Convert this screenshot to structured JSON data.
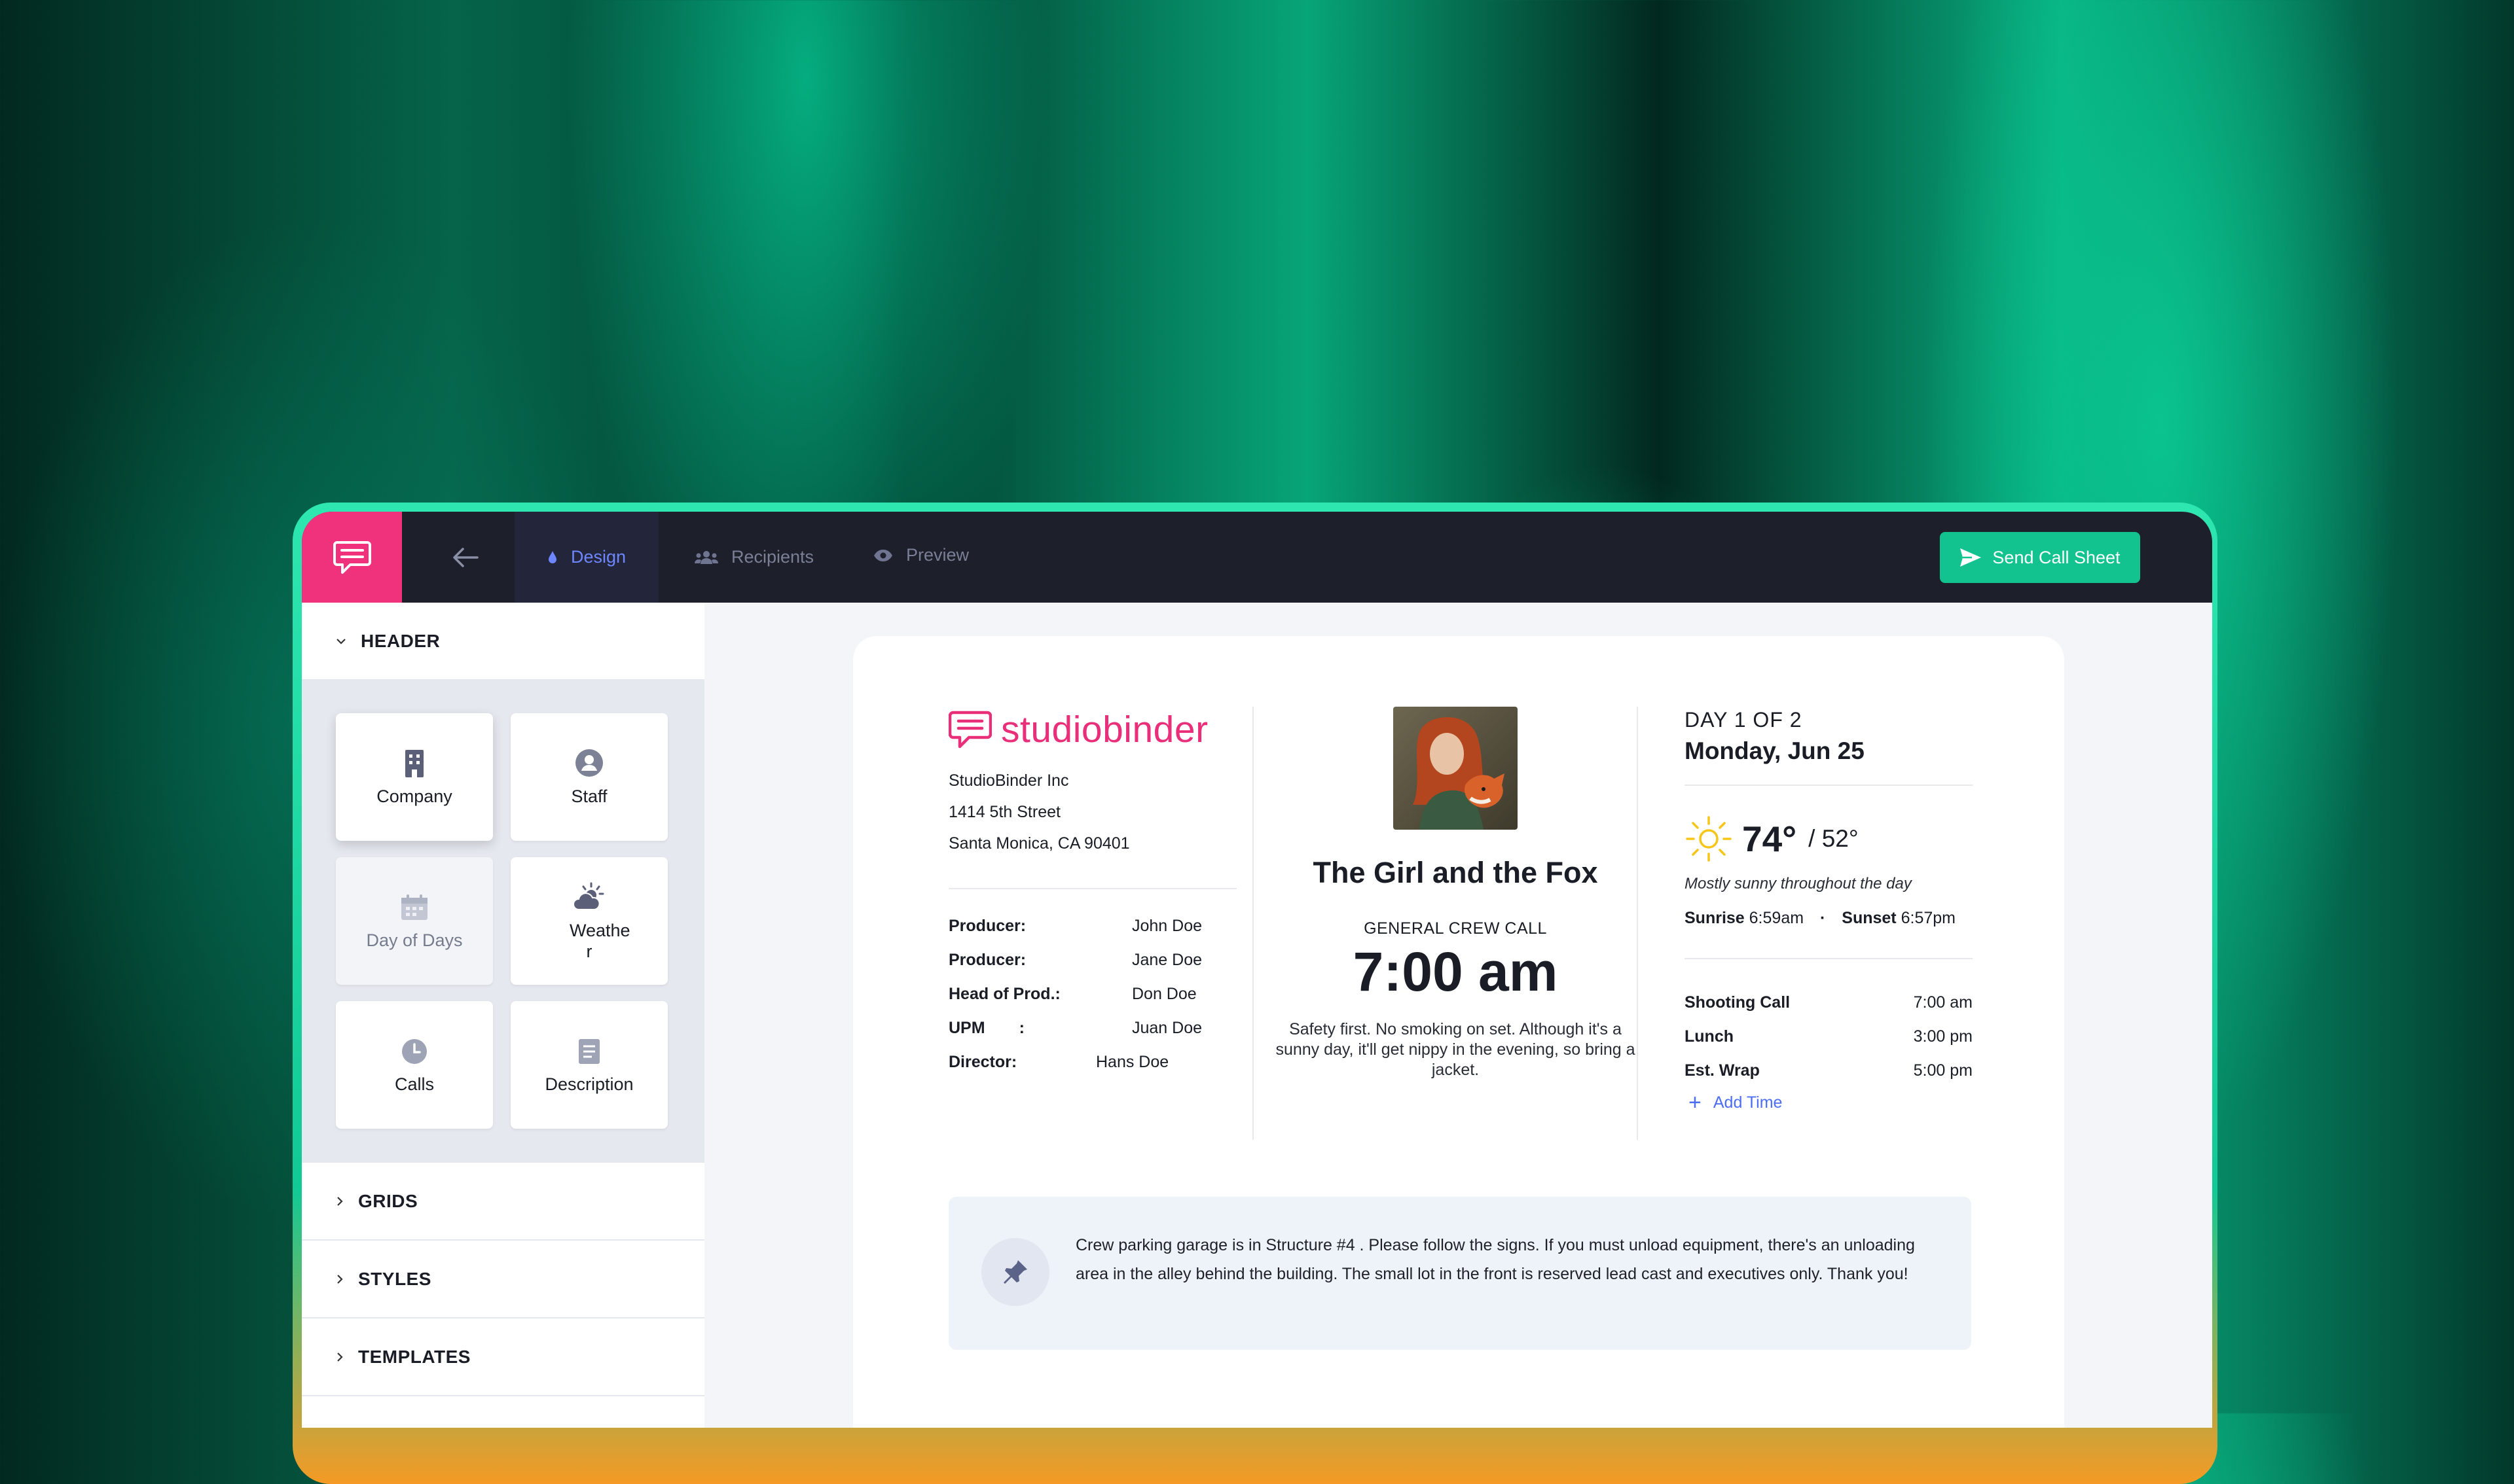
{
  "colors": {
    "brand": "#f0317c",
    "accent": "#12c28f",
    "active_tab": "#6e86ff",
    "topbar": "#1d1f2b"
  },
  "topbar": {
    "tabs": [
      {
        "label": "Design",
        "icon": "droplet-icon",
        "active": true
      },
      {
        "label": "Recipients",
        "icon": "people-icon"
      },
      {
        "label": "Preview",
        "icon": "eye-icon"
      }
    ],
    "send_label": "Send Call Sheet"
  },
  "sidebar": {
    "header_label": "HEADER",
    "blocks": [
      {
        "label": "Company",
        "icon": "building-icon"
      },
      {
        "label": "Staff",
        "icon": "person-icon"
      },
      {
        "label": "Day of Days",
        "icon": "calendar-icon",
        "disabled": true
      },
      {
        "label": "Weathe r",
        "icon": "cloud-sun-icon"
      },
      {
        "label": "Calls",
        "icon": "clock-icon"
      },
      {
        "label": "Description",
        "icon": "document-icon"
      }
    ],
    "sections": [
      "GRIDS",
      "STYLES",
      "TEMPLATES"
    ]
  },
  "callsheet": {
    "brand_word": "studiobinder",
    "company": {
      "name": "StudioBinder Inc",
      "street": "1414 5th Street",
      "city": "Santa Monica, CA 90401"
    },
    "crew": [
      {
        "role": "Producer:",
        "name": "John Doe"
      },
      {
        "role": "Producer:",
        "name": "Jane Doe"
      },
      {
        "role": "Head of Prod.:",
        "name": "Don Doe"
      },
      {
        "role": "UPM",
        "sep": ":",
        "name": "Juan Doe"
      },
      {
        "role": "Director:",
        "name": "Hans Doe"
      }
    ],
    "project_title": "The Girl and the Fox",
    "general_crew_call_label": "GENERAL CREW CALL",
    "general_crew_call_time": "7:00 am",
    "note": "Safety first. No smoking on set. Although it's a sunny day, it'll get nippy in the evening, so bring a jacket.",
    "day_of": "DAY 1 OF 2",
    "date": "Monday, Jun 25",
    "weather": {
      "high": "74°",
      "low": "/ 52°",
      "description": "Mostly sunny throughout the day",
      "sunrise_label": "Sunrise",
      "sunrise": "6:59am",
      "sunset_label": "Sunset",
      "sunset": "6:57pm"
    },
    "times": [
      {
        "label": "Shooting Call",
        "time": "7:00 am"
      },
      {
        "label": "Lunch",
        "time": "3:00 pm"
      },
      {
        "label": "Est. Wrap",
        "time": "5:00 pm"
      }
    ],
    "add_time_label": "Add Time",
    "notice": "Crew parking garage is in Structure #4 . Please follow the signs. If you must unload equipment, there's an unloading area in the alley behind the building. The small lot in the front is reserved lead cast and executives only. Thank you!"
  }
}
